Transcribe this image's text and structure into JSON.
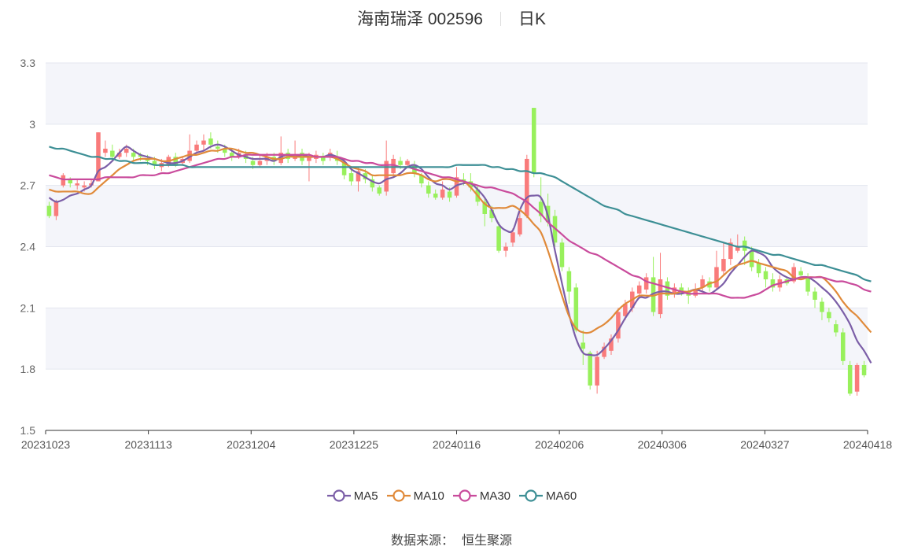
{
  "header": {
    "stock": "海南瑞泽 002596",
    "period": "日K"
  },
  "source": {
    "label": "数据来源：",
    "value": "恒生聚源"
  },
  "chart_data": {
    "type": "candlestick",
    "title": "海南瑞泽 002596",
    "ylim": [
      1.5,
      3.3
    ],
    "yticks": [
      "1.5",
      "1.8",
      "2.1",
      "2.4",
      "2.7",
      "3",
      "3.3"
    ],
    "xticks": [
      "20231023",
      "20231113",
      "20231204",
      "20231225",
      "20240116",
      "20240206",
      "20240306",
      "20240327",
      "20240418"
    ],
    "colors": {
      "up": "#f97b7b",
      "down": "#98f05c",
      "band": "#f4f5fa",
      "grid": "#e3e6ef"
    },
    "candles": [
      [
        2.6,
        2.55,
        2.62,
        2.54
      ],
      [
        2.55,
        2.62,
        2.63,
        2.53
      ],
      [
        2.7,
        2.75,
        2.76,
        2.69
      ],
      [
        2.73,
        2.71,
        2.74,
        2.69
      ],
      [
        2.7,
        2.71,
        2.73,
        2.68
      ],
      [
        2.69,
        2.7,
        2.72,
        2.67
      ],
      [
        2.7,
        2.71,
        2.73,
        2.69
      ],
      [
        2.72,
        2.96,
        2.96,
        2.72
      ],
      [
        2.86,
        2.88,
        2.92,
        2.84
      ],
      [
        2.87,
        2.84,
        2.9,
        2.82
      ],
      [
        2.84,
        2.86,
        2.88,
        2.83
      ],
      [
        2.86,
        2.88,
        2.9,
        2.84
      ],
      [
        2.86,
        2.84,
        2.88,
        2.82
      ],
      [
        2.85,
        2.84,
        2.86,
        2.82
      ],
      [
        2.83,
        2.82,
        2.85,
        2.8
      ],
      [
        2.82,
        2.8,
        2.84,
        2.78
      ],
      [
        2.79,
        2.81,
        2.83,
        2.77
      ],
      [
        2.8,
        2.84,
        2.85,
        2.79
      ],
      [
        2.84,
        2.8,
        2.86,
        2.79
      ],
      [
        2.81,
        2.83,
        2.84,
        2.8
      ],
      [
        2.82,
        2.87,
        2.95,
        2.81
      ],
      [
        2.87,
        2.9,
        2.92,
        2.86
      ],
      [
        2.9,
        2.92,
        2.95,
        2.87
      ],
      [
        2.93,
        2.9,
        2.96,
        2.88
      ],
      [
        2.89,
        2.88,
        2.92,
        2.86
      ],
      [
        2.88,
        2.86,
        2.9,
        2.84
      ],
      [
        2.86,
        2.84,
        2.88,
        2.82
      ],
      [
        2.84,
        2.86,
        2.88,
        2.83
      ],
      [
        2.85,
        2.83,
        2.87,
        2.81
      ],
      [
        2.82,
        2.8,
        2.84,
        2.78
      ],
      [
        2.8,
        2.82,
        2.85,
        2.79
      ],
      [
        2.82,
        2.84,
        2.86,
        2.8
      ],
      [
        2.84,
        2.82,
        2.86,
        2.8
      ],
      [
        2.81,
        2.86,
        2.94,
        2.8
      ],
      [
        2.86,
        2.83,
        2.88,
        2.81
      ],
      [
        2.83,
        2.85,
        2.92,
        2.82
      ],
      [
        2.86,
        2.82,
        2.88,
        2.8
      ],
      [
        2.82,
        2.84,
        2.86,
        2.72
      ],
      [
        2.83,
        2.85,
        2.87,
        2.81
      ],
      [
        2.84,
        2.82,
        2.86,
        2.8
      ],
      [
        2.84,
        2.86,
        2.88,
        2.82
      ],
      [
        2.84,
        2.82,
        2.87,
        2.8
      ],
      [
        2.81,
        2.75,
        2.82,
        2.73
      ],
      [
        2.76,
        2.72,
        2.78,
        2.7
      ],
      [
        2.72,
        2.77,
        2.79,
        2.67
      ],
      [
        2.76,
        2.73,
        2.78,
        2.71
      ],
      [
        2.73,
        2.69,
        2.75,
        2.67
      ],
      [
        2.69,
        2.66,
        2.7,
        2.65
      ],
      [
        2.67,
        2.82,
        2.92,
        2.65
      ],
      [
        2.76,
        2.83,
        2.85,
        2.74
      ],
      [
        2.82,
        2.8,
        2.84,
        2.78
      ],
      [
        2.8,
        2.82,
        2.83,
        2.79
      ],
      [
        2.8,
        2.76,
        2.82,
        2.74
      ],
      [
        2.75,
        2.71,
        2.76,
        2.69
      ],
      [
        2.7,
        2.66,
        2.72,
        2.64
      ],
      [
        2.66,
        2.64,
        2.68,
        2.63
      ],
      [
        2.64,
        2.68,
        2.72,
        2.63
      ],
      [
        2.67,
        2.64,
        2.69,
        2.62
      ],
      [
        2.65,
        2.74,
        2.79,
        2.64
      ],
      [
        2.73,
        2.72,
        2.76,
        2.7
      ],
      [
        2.72,
        2.69,
        2.76,
        2.67
      ],
      [
        2.68,
        2.62,
        2.7,
        2.6
      ],
      [
        2.62,
        2.56,
        2.64,
        2.5
      ],
      [
        2.58,
        2.54,
        2.6,
        2.52
      ],
      [
        2.5,
        2.38,
        2.52,
        2.37
      ],
      [
        2.38,
        2.4,
        2.42,
        2.35
      ],
      [
        2.42,
        2.47,
        2.49,
        2.4
      ],
      [
        2.46,
        2.54,
        2.57,
        2.45
      ],
      [
        2.55,
        2.83,
        2.85,
        2.54
      ],
      [
        3.08,
        2.76,
        3.08,
        2.74
      ],
      [
        2.62,
        2.55,
        2.74,
        2.52
      ],
      [
        2.6,
        2.52,
        2.66,
        2.5
      ],
      [
        2.55,
        2.42,
        2.58,
        2.4
      ],
      [
        2.42,
        2.3,
        2.44,
        2.28
      ],
      [
        2.28,
        2.18,
        2.3,
        2.12
      ],
      [
        2.2,
        1.99,
        2.22,
        1.98
      ],
      [
        1.93,
        1.9,
        1.99,
        1.82
      ],
      [
        1.88,
        1.72,
        1.89,
        1.7
      ],
      [
        1.72,
        1.86,
        1.89,
        1.68
      ],
      [
        1.86,
        1.91,
        1.93,
        1.85
      ],
      [
        1.89,
        1.95,
        1.97,
        1.87
      ],
      [
        1.95,
        2.08,
        2.1,
        1.93
      ],
      [
        2.06,
        2.12,
        2.14,
        2.04
      ],
      [
        2.1,
        2.18,
        2.2,
        2.08
      ],
      [
        2.17,
        2.21,
        2.23,
        2.15
      ],
      [
        2.19,
        2.25,
        2.27,
        2.17
      ],
      [
        2.25,
        2.08,
        2.35,
        2.06
      ],
      [
        2.07,
        2.24,
        2.37,
        2.05
      ],
      [
        2.23,
        2.16,
        2.25,
        2.14
      ],
      [
        2.17,
        2.2,
        2.22,
        2.15
      ],
      [
        2.2,
        2.18,
        2.22,
        2.16
      ],
      [
        2.18,
        2.16,
        2.2,
        2.12
      ],
      [
        2.16,
        2.19,
        2.22,
        2.15
      ],
      [
        2.2,
        2.24,
        2.26,
        2.18
      ],
      [
        2.23,
        2.2,
        2.25,
        2.18
      ],
      [
        2.2,
        2.3,
        2.38,
        2.19
      ],
      [
        2.28,
        2.34,
        2.42,
        2.26
      ],
      [
        2.34,
        2.42,
        2.44,
        2.31
      ],
      [
        2.38,
        2.4,
        2.46,
        2.37
      ],
      [
        2.43,
        2.38,
        2.45,
        2.31
      ],
      [
        2.38,
        2.3,
        2.4,
        2.28
      ],
      [
        2.32,
        2.27,
        2.34,
        2.25
      ],
      [
        2.28,
        2.24,
        2.3,
        2.2
      ],
      [
        2.24,
        2.2,
        2.27,
        2.18
      ],
      [
        2.2,
        2.24,
        2.26,
        2.18
      ],
      [
        2.24,
        2.22,
        2.25,
        2.21
      ],
      [
        2.23,
        2.3,
        2.32,
        2.22
      ],
      [
        2.28,
        2.26,
        2.3,
        2.24
      ],
      [
        2.25,
        2.18,
        2.27,
        2.16
      ],
      [
        2.18,
        2.14,
        2.2,
        2.1
      ],
      [
        2.13,
        2.08,
        2.15,
        2.04
      ],
      [
        2.08,
        2.05,
        2.1,
        2.03
      ],
      [
        2.02,
        1.98,
        2.04,
        1.96
      ],
      [
        1.98,
        1.84,
        2.0,
        1.82
      ],
      [
        1.82,
        1.68,
        1.84,
        1.67
      ],
      [
        1.69,
        1.82,
        1.83,
        1.67
      ],
      [
        1.82,
        1.77,
        1.84,
        1.76
      ]
    ],
    "series": [
      {
        "name": "MA5",
        "color": "#7b5ea7",
        "values": [
          2.64,
          2.62,
          2.63,
          2.65,
          2.66,
          2.68,
          2.7,
          2.77,
          2.79,
          2.82,
          2.86,
          2.89,
          2.87,
          2.85,
          2.84,
          2.83,
          2.82,
          2.81,
          2.81,
          2.82,
          2.84,
          2.86,
          2.87,
          2.89,
          2.9,
          2.89,
          2.87,
          2.85,
          2.84,
          2.83,
          2.83,
          2.83,
          2.82,
          2.84,
          2.85,
          2.84,
          2.85,
          2.84,
          2.84,
          2.84,
          2.85,
          2.84,
          2.82,
          2.78,
          2.76,
          2.74,
          2.72,
          2.71,
          2.73,
          2.74,
          2.76,
          2.79,
          2.8,
          2.78,
          2.74,
          2.71,
          2.7,
          2.68,
          2.7,
          2.71,
          2.71,
          2.68,
          2.64,
          2.58,
          2.51,
          2.48,
          2.48,
          2.58,
          2.64,
          2.65,
          2.64,
          2.55,
          2.38,
          2.22,
          2.07,
          1.95,
          1.88,
          1.87,
          1.87,
          1.9,
          1.94,
          1.99,
          2.05,
          2.1,
          2.15,
          2.15,
          2.17,
          2.18,
          2.18,
          2.17,
          2.17,
          2.18,
          2.19,
          2.18,
          2.17,
          2.19,
          2.22,
          2.27,
          2.31,
          2.35,
          2.38,
          2.37,
          2.35,
          2.3,
          2.27,
          2.25,
          2.24,
          2.25,
          2.25,
          2.23,
          2.2,
          2.17,
          2.13,
          2.08,
          2.02,
          1.94,
          1.89,
          1.83
        ]
      },
      {
        "name": "MA10",
        "color": "#e08a3a",
        "values": [
          2.68,
          2.67,
          2.67,
          2.67,
          2.67,
          2.66,
          2.66,
          2.69,
          2.72,
          2.75,
          2.78,
          2.8,
          2.82,
          2.83,
          2.83,
          2.83,
          2.82,
          2.82,
          2.83,
          2.84,
          2.85,
          2.85,
          2.86,
          2.87,
          2.87,
          2.88,
          2.88,
          2.87,
          2.86,
          2.86,
          2.85,
          2.84,
          2.83,
          2.83,
          2.84,
          2.84,
          2.84,
          2.84,
          2.84,
          2.84,
          2.84,
          2.83,
          2.81,
          2.79,
          2.78,
          2.77,
          2.75,
          2.75,
          2.75,
          2.75,
          2.75,
          2.76,
          2.76,
          2.75,
          2.73,
          2.72,
          2.73,
          2.73,
          2.72,
          2.72,
          2.69,
          2.65,
          2.61,
          2.59,
          2.59,
          2.59,
          2.6,
          2.58,
          2.55,
          2.51,
          2.47,
          2.38,
          2.27,
          2.16,
          2.06,
          2.0,
          1.98,
          1.98,
          2.0,
          2.02,
          2.05,
          2.09,
          2.12,
          2.14,
          2.16,
          2.16,
          2.16,
          2.17,
          2.17,
          2.17,
          2.18,
          2.18,
          2.19,
          2.2,
          2.22,
          2.23,
          2.26,
          2.29,
          2.31,
          2.32,
          2.33,
          2.32,
          2.31,
          2.3,
          2.29,
          2.28,
          2.25,
          2.24,
          2.25,
          2.25,
          2.25,
          2.22,
          2.18,
          2.13,
          2.09,
          2.06,
          2.02,
          1.98
        ]
      },
      {
        "name": "MA30",
        "color": "#c94b9c",
        "values": [
          2.75,
          2.74,
          2.73,
          2.73,
          2.73,
          2.73,
          2.73,
          2.73,
          2.74,
          2.74,
          2.74,
          2.74,
          2.74,
          2.75,
          2.75,
          2.75,
          2.76,
          2.76,
          2.77,
          2.78,
          2.79,
          2.8,
          2.81,
          2.82,
          2.83,
          2.83,
          2.84,
          2.84,
          2.85,
          2.85,
          2.85,
          2.85,
          2.85,
          2.85,
          2.85,
          2.85,
          2.85,
          2.85,
          2.84,
          2.84,
          2.84,
          2.84,
          2.83,
          2.82,
          2.82,
          2.81,
          2.81,
          2.8,
          2.8,
          2.8,
          2.79,
          2.79,
          2.78,
          2.77,
          2.76,
          2.75,
          2.74,
          2.74,
          2.73,
          2.72,
          2.71,
          2.7,
          2.69,
          2.69,
          2.68,
          2.67,
          2.66,
          2.64,
          2.62,
          2.59,
          2.56,
          2.52,
          2.49,
          2.46,
          2.43,
          2.41,
          2.39,
          2.37,
          2.36,
          2.34,
          2.32,
          2.3,
          2.28,
          2.26,
          2.25,
          2.23,
          2.22,
          2.21,
          2.2,
          2.19,
          2.18,
          2.17,
          2.17,
          2.17,
          2.17,
          2.17,
          2.16,
          2.15,
          2.15,
          2.15,
          2.16,
          2.17,
          2.19,
          2.21,
          2.22,
          2.23,
          2.24,
          2.25,
          2.25,
          2.25,
          2.25,
          2.24,
          2.23,
          2.23,
          2.22,
          2.21,
          2.19,
          2.18
        ]
      },
      {
        "name": "MA60",
        "color": "#3d8f95",
        "values": [
          2.89,
          2.88,
          2.88,
          2.87,
          2.86,
          2.85,
          2.84,
          2.84,
          2.83,
          2.83,
          2.82,
          2.82,
          2.81,
          2.81,
          2.81,
          2.8,
          2.8,
          2.8,
          2.8,
          2.8,
          2.79,
          2.79,
          2.79,
          2.79,
          2.79,
          2.79,
          2.79,
          2.79,
          2.79,
          2.79,
          2.79,
          2.79,
          2.79,
          2.79,
          2.79,
          2.79,
          2.79,
          2.79,
          2.79,
          2.79,
          2.79,
          2.79,
          2.79,
          2.79,
          2.79,
          2.79,
          2.79,
          2.79,
          2.79,
          2.79,
          2.79,
          2.79,
          2.79,
          2.79,
          2.79,
          2.79,
          2.79,
          2.79,
          2.8,
          2.8,
          2.8,
          2.8,
          2.8,
          2.79,
          2.79,
          2.78,
          2.78,
          2.77,
          2.77,
          2.76,
          2.76,
          2.75,
          2.74,
          2.72,
          2.7,
          2.68,
          2.66,
          2.64,
          2.62,
          2.6,
          2.59,
          2.58,
          2.56,
          2.55,
          2.54,
          2.53,
          2.52,
          2.51,
          2.5,
          2.49,
          2.48,
          2.47,
          2.46,
          2.45,
          2.44,
          2.43,
          2.42,
          2.41,
          2.4,
          2.4,
          2.39,
          2.38,
          2.37,
          2.36,
          2.36,
          2.35,
          2.34,
          2.33,
          2.32,
          2.31,
          2.31,
          2.3,
          2.29,
          2.28,
          2.27,
          2.26,
          2.24,
          2.23
        ]
      }
    ]
  }
}
